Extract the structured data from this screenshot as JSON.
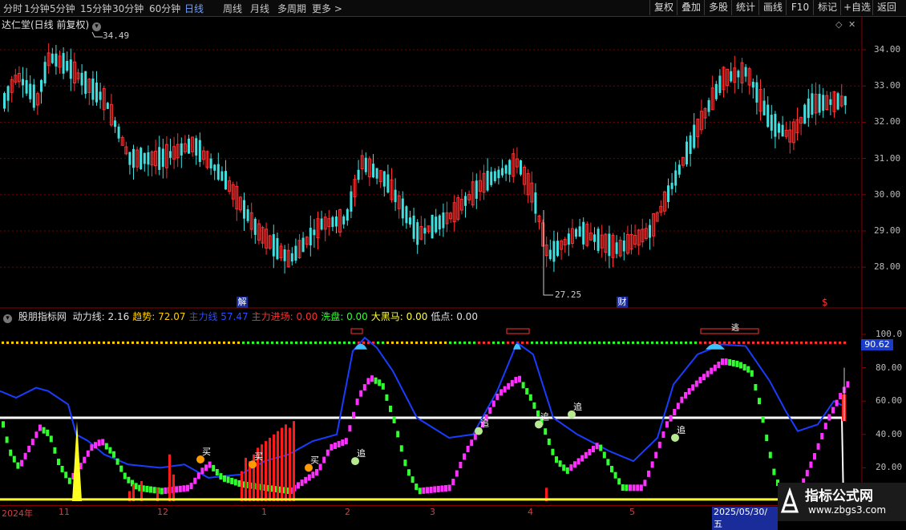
{
  "toolbar": {
    "timeframes": [
      {
        "label": "分时",
        "active": false
      },
      {
        "label": "1分钟",
        "active": false
      },
      {
        "label": "5分钟",
        "active": false
      },
      {
        "label": "15分钟",
        "active": false
      },
      {
        "label": "30分钟",
        "active": false
      },
      {
        "label": "60分钟",
        "active": false
      },
      {
        "label": "日线",
        "active": true
      },
      {
        "label": "周线",
        "active": false
      },
      {
        "label": "月线",
        "active": false
      },
      {
        "label": "多周期",
        "active": false
      },
      {
        "label": "更多 >",
        "active": false
      }
    ],
    "right_buttons": [
      "复权",
      "叠加",
      "多股",
      "统计",
      "画线",
      "F10",
      "标记",
      "+自选",
      "返回"
    ]
  },
  "stock": {
    "title": "达仁堂(日线 前复权)"
  },
  "price_chart": {
    "y_ticks": [
      "34.00",
      "33.00",
      "32.00",
      "31.00",
      "30.00",
      "29.00",
      "28.00"
    ],
    "high_label": "34.49",
    "low_label": "27.25",
    "markers": [
      "解",
      "财",
      "$"
    ]
  },
  "indicator": {
    "name": "股朋指标网",
    "items": [
      {
        "label": "动力线:",
        "value": "2.16",
        "color": "#e0e0e0"
      },
      {
        "label": "趋势:",
        "value": "72.07",
        "color": "#ffd000"
      },
      {
        "label": "主力线",
        "value": "57.47",
        "color": "#2b4bff"
      },
      {
        "label": "主力进场:",
        "value": "0.00",
        "color": "#ff3030"
      },
      {
        "label": "洗盘:",
        "value": "0.00",
        "color": "#30ff30"
      },
      {
        "label": "大黑马:",
        "value": "0.00",
        "color": "#ffff40"
      },
      {
        "label": "低点:",
        "value": "0.00",
        "color": "#e0e0e0"
      }
    ],
    "y_ticks": [
      "100.0",
      "80.00",
      "60.00",
      "40.00",
      "20.00"
    ],
    "current_badge": "90.62",
    "signals": {
      "buy": "买",
      "chase": "追",
      "flee": "逃"
    }
  },
  "dates": {
    "labels": [
      "2024年",
      "11",
      "12",
      "1",
      "2",
      "3",
      "4",
      "5"
    ],
    "selected": "2025/05/30/五"
  },
  "watermark": {
    "title": "指标公式网",
    "url": "www.zbgs3.com"
  },
  "colors": {
    "up": "#ff3030",
    "down": "#40e0e0",
    "magenta": "#ff30ff",
    "green": "#30ff30",
    "blue": "#1a3cff",
    "yellow": "#ffff20"
  }
}
